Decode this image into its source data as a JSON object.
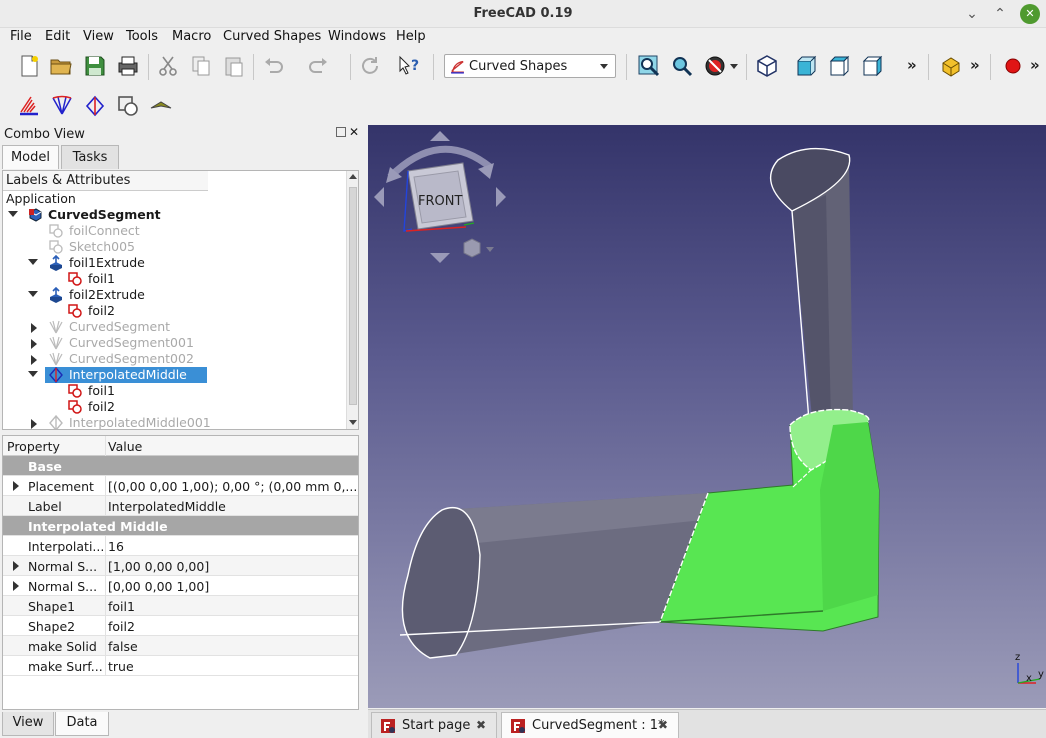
{
  "window": {
    "title": "FreeCAD 0.19"
  },
  "menu": [
    "File",
    "Edit",
    "View",
    "Tools",
    "Macro",
    "Curved Shapes",
    "Windows",
    "Help"
  ],
  "toolbar": {
    "workbench": "Curved Shapes",
    "chevron": "»"
  },
  "combo": {
    "title": "Combo View",
    "tabs": [
      "Model",
      "Tasks"
    ],
    "tree_header": "Labels & Attributes",
    "tree": [
      {
        "label": "Application",
        "style": "normal"
      },
      {
        "label": "CurvedSegment",
        "style": "bold",
        "expander": "down"
      },
      {
        "label": "foilConnect",
        "style": "gray"
      },
      {
        "label": "Sketch005",
        "style": "gray"
      },
      {
        "label": "foil1Extrude",
        "style": "normal",
        "expander": "down"
      },
      {
        "label": "foil1",
        "style": "normal"
      },
      {
        "label": "foil2Extrude",
        "style": "normal",
        "expander": "down"
      },
      {
        "label": "foil2",
        "style": "normal"
      },
      {
        "label": "CurvedSegment",
        "style": "gray",
        "expander": "right"
      },
      {
        "label": "CurvedSegment001",
        "style": "gray",
        "expander": "right"
      },
      {
        "label": "CurvedSegment002",
        "style": "gray",
        "expander": "right"
      },
      {
        "label": "InterpolatedMiddle",
        "style": "selected",
        "expander": "down"
      },
      {
        "label": "foil1",
        "style": "normal"
      },
      {
        "label": "foil2",
        "style": "normal"
      },
      {
        "label": "InterpolatedMiddle001",
        "style": "gray",
        "expander": "right"
      }
    ]
  },
  "properties": {
    "header": {
      "property": "Property",
      "value": "Value"
    },
    "groups": [
      {
        "name": "Base",
        "rows": [
          {
            "name": "Placement",
            "value": "[(0,00 0,00 1,00); 0,00 °; (0,00 mm  0,...",
            "expandable": true
          },
          {
            "name": "Label",
            "value": "InterpolatedMiddle"
          }
        ]
      },
      {
        "name": "Interpolated Middle",
        "rows": [
          {
            "name": "Interpolati...",
            "value": "16"
          },
          {
            "name": "Normal S...",
            "value": "[1,00 0,00 0,00]",
            "expandable": true
          },
          {
            "name": "Normal S...",
            "value": "[0,00 0,00 1,00]",
            "expandable": true
          },
          {
            "name": "Shape1",
            "value": "foil1"
          },
          {
            "name": "Shape2",
            "value": "foil2"
          },
          {
            "name": "make Solid",
            "value": "false"
          },
          {
            "name": "make Surf...",
            "value": "true"
          }
        ]
      }
    ]
  },
  "bottom_tabs": [
    "View",
    "Data"
  ],
  "viewport": {
    "nav_cube_face": "FRONT",
    "axis_labels": [
      "z",
      "x",
      "y"
    ]
  },
  "doc_tabs": [
    {
      "label": "Start page",
      "close": "✖"
    },
    {
      "label": "CurvedSegment : 1*",
      "close": "✖"
    }
  ],
  "colors": {
    "selection": "#3a8fd6",
    "green_shape": "#5ee85a",
    "gray_shape": "#6a6a7a",
    "group_row": "#a6a6a6"
  }
}
